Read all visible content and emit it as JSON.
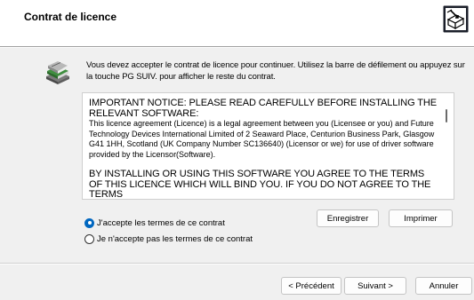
{
  "dialog": {
    "title": "Contrat de licence"
  },
  "header_icon": "installer-box-icon",
  "content_icon": "books-icon",
  "instruction": "Vous devez accepter le contrat de licence pour continuer. Utilisez la barre de défilement ou appuyez sur la touche PG SUIV. pour afficher le reste du contrat.",
  "license": {
    "notice": "IMPORTANT NOTICE: PLEASE READ CAREFULLY BEFORE INSTALLING THE RELEVANT SOFTWARE:",
    "paragraph1": "This licence agreement (Licence) is a legal agreement between you (Licensee or you) and Future Technology Devices International Limited of 2 Seaward Place, Centurion Business Park, Glasgow G41 1HH, Scotland (UK Company Number SC136640) (Licensor or we) for use of driver software provided by the Licensor(Software).",
    "paragraph2": "BY INSTALLING OR USING THIS SOFTWARE YOU AGREE TO THE TERMS OF THIS LICENCE WHICH WILL BIND YOU.  IF YOU DO NOT AGREE TO THE TERMS"
  },
  "options": {
    "accept": "J'accepte les termes de ce contrat",
    "decline": "Je n'accepte pas les termes de ce contrat",
    "selected": "accept"
  },
  "buttons": {
    "save": "Enregistrer",
    "print": "Imprimer",
    "back": "< Précédent",
    "next": "Suivant >",
    "cancel": "Annuler"
  }
}
